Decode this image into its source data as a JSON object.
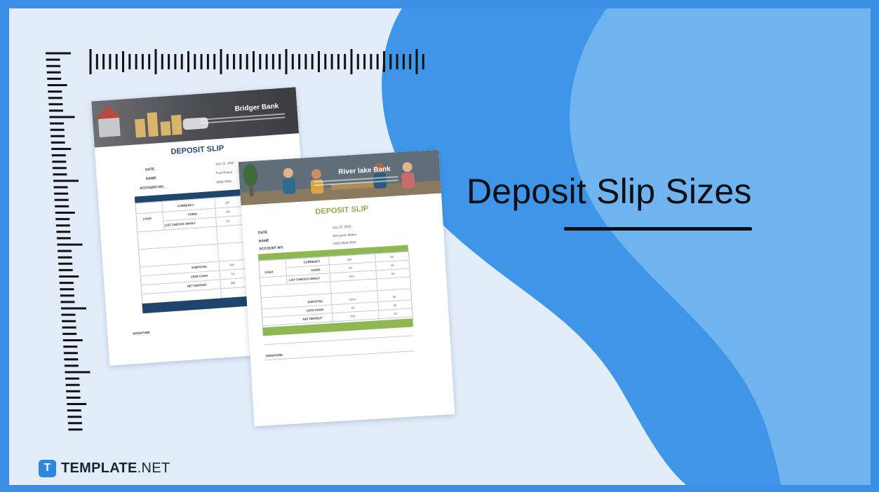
{
  "headline": "Deposit Slip Sizes",
  "brand": {
    "mark": "T",
    "bold": "TEMPLATE",
    "light": ".NET",
    "color": "#2e86de"
  },
  "colors": {
    "frame": "#3b8fe6",
    "background": "#e2edf9",
    "wave_dark": "#3f96e8",
    "wave_light": "#6fb4ee"
  },
  "doc_back": {
    "bank_name": "Bridger Bank",
    "title": "DEPOSIT SLIP",
    "fields": [
      {
        "label": "DATE",
        "value": "July 15, 2050"
      },
      {
        "label": "NAME",
        "value": "Fred Rivera"
      },
      {
        "label": "ACCOUNT NO.",
        "value": "0000 0000"
      }
    ],
    "rows": [
      {
        "group": "CASH",
        "label": "CURRENCY",
        "value": "250"
      },
      {
        "group": "",
        "label": "COINS",
        "value": "100"
      },
      {
        "group": "",
        "label": "LIST CHECKS SINGLY",
        "value": "50"
      }
    ],
    "totals": [
      {
        "label": "SUBTOTAL",
        "value": "300"
      },
      {
        "label": "LESS CASH",
        "value": "15"
      },
      {
        "label": "NET DEPOSIT",
        "value": "580"
      }
    ],
    "signature": "SIGNATURE",
    "accent": "#1f456d"
  },
  "doc_front": {
    "bank_name": "River lake Bank",
    "title": "DEPOSIT SLIP",
    "fields": [
      {
        "label": "DATE",
        "value": "July 15, 2050"
      },
      {
        "label": "NAME",
        "value": "Benyamin Mateo"
      },
      {
        "label": "ACCOUNT NO.",
        "value": "0000 0000 0000"
      }
    ],
    "rows": [
      {
        "group": "CASH",
        "label": "CURRENCY",
        "value": "250",
        "cents": "00"
      },
      {
        "group": "",
        "label": "COINS",
        "value": "60",
        "cents": "00"
      },
      {
        "group": "",
        "label": "LIST CHECKS SINGLY",
        "value": "Box",
        "cents": "00"
      }
    ],
    "totals": [
      {
        "label": "SUBTOTAL",
        "value": "None",
        "cents": "00"
      },
      {
        "label": "LESS CASH",
        "value": "50",
        "cents": "25"
      },
      {
        "label": "NET DEPOSIT",
        "value": "300",
        "cents": "00"
      }
    ],
    "signature": "SIGNATURE",
    "accent": "#8fb852"
  }
}
